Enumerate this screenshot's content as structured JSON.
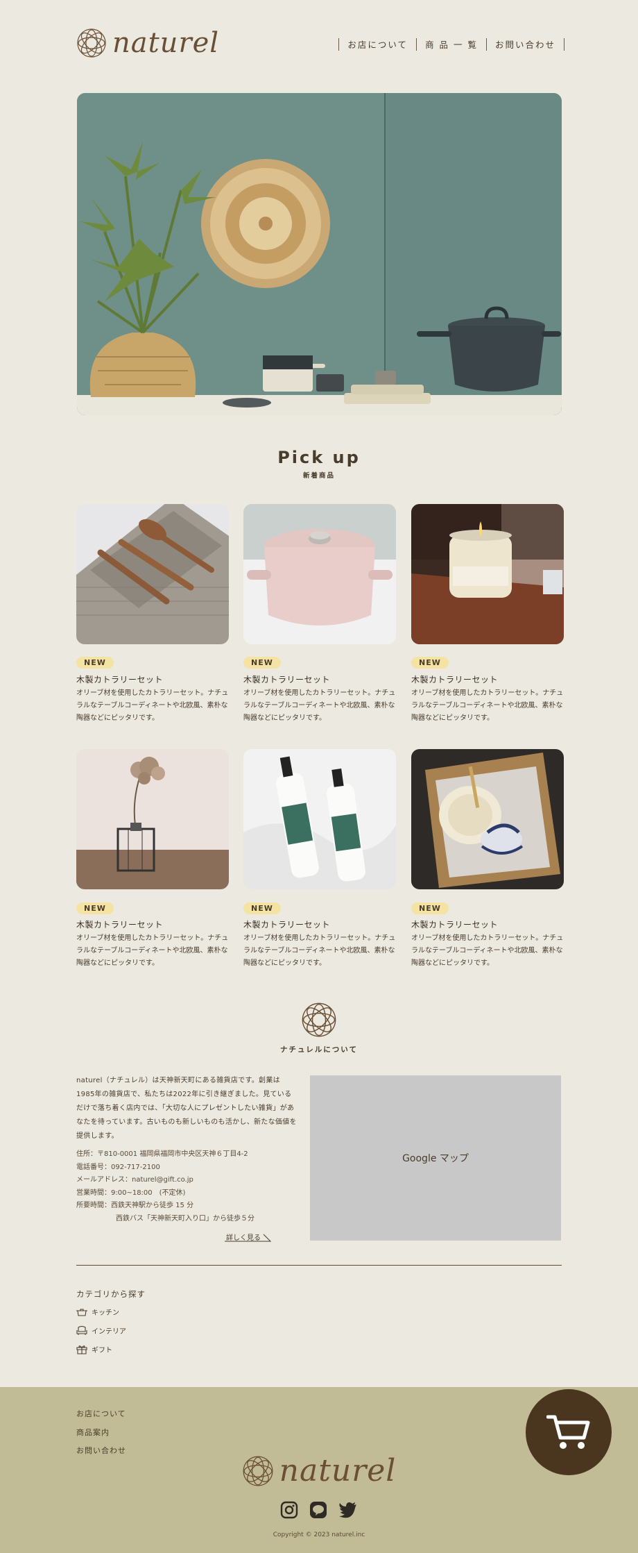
{
  "header": {
    "brand": "naturel",
    "nav": [
      "お店について",
      "商 品 一 覧",
      "お問い合わせ"
    ]
  },
  "pickup": {
    "title": "Pick up",
    "subtitle": "新着商品",
    "cards": [
      {
        "badge": "NEW",
        "title": "木製カトラリーセット",
        "desc": "オリーブ材を使用したカトラリーセット。ナチュラルなテーブルコーディネートや北欧風、素朴な陶器などにピッタリです。",
        "image": "cutlery-wrap"
      },
      {
        "badge": "NEW",
        "title": "木製カトラリーセット",
        "desc": "オリーブ材を使用したカトラリーセット。ナチュラルなテーブルコーディネートや北欧風、素朴な陶器などにピッタリです。",
        "image": "pink-pot"
      },
      {
        "badge": "NEW",
        "title": "木製カトラリーセット",
        "desc": "オリーブ材を使用したカトラリーセット。ナチュラルなテーブルコーディネートや北欧風、素朴な陶器などにピッタリです。",
        "image": "candle"
      },
      {
        "badge": "NEW",
        "title": "木製カトラリーセット",
        "desc": "オリーブ材を使用したカトラリーセット。ナチュラルなテーブルコーディネートや北欧風、素朴な陶器などにピッタリです。",
        "image": "dried-flower-vase"
      },
      {
        "badge": "NEW",
        "title": "木製カトラリーセット",
        "desc": "オリーブ材を使用したカトラリーセット。ナチュラルなテーブルコーディネートや北欧風、素朴な陶器などにピッタリです。",
        "image": "lotion-bottles"
      },
      {
        "badge": "NEW",
        "title": "木製カトラリーセット",
        "desc": "オリーブ材を使用したカトラリーセット。ナチュラルなテーブルコーディネートや北欧風、素朴な陶器などにピッタリです。",
        "image": "basket-dishes"
      }
    ]
  },
  "about": {
    "title": "ナチュレルについて",
    "text": "naturel（ナチュレル）は天神新天町にある雑貨店です。創業は1985年の雑貨店で、私たちは2022年に引き継ぎました。見ているだけで落ち着く店内では、「大切な人にプレゼントしたい雑貨」があなたを待っています。古いものも新しいものも活かし、新たな価値を提供します。",
    "info": [
      "住所：〒810-0001 福岡県福岡市中央区天神６丁目4-2",
      "電話番号：092-717-2100",
      "メールアドレス：naturel@gift.co.jp",
      "営業時間：9:00~18:00　(不定休)",
      "所要時間：西鉄天神駅から徒歩 15 分",
      "西鉄バス「天神新天町入り口」から徒歩５分"
    ],
    "more": "詳しく見る",
    "map_label": "Google マップ"
  },
  "categories": {
    "title": "カテゴリから探す",
    "items": [
      {
        "label": "キッチン",
        "icon": "pot-icon"
      },
      {
        "label": "インテリア",
        "icon": "chair-icon"
      },
      {
        "label": "ギフト",
        "icon": "gift-icon"
      }
    ]
  },
  "footer": {
    "links": [
      "お店について",
      "商品案内",
      "お問い合わせ"
    ],
    "brand": "naturel",
    "copyright": "Copyright © 2023 naturel.inc"
  },
  "colors": {
    "background": "#ebe9e0",
    "footer": "#c1bb96",
    "brand_brown": "#6b4f35",
    "badge": "#f4e3a3",
    "cart": "#4a361f"
  }
}
